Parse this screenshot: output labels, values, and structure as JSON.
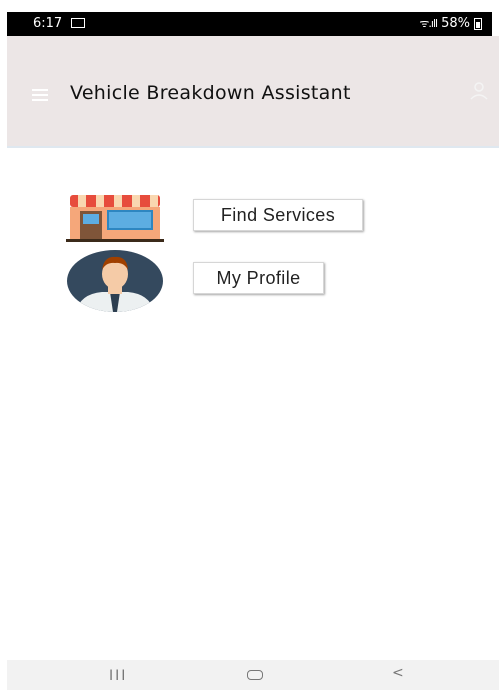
{
  "status_bar": {
    "time": "6:17",
    "signal": "ᯤ.ıll",
    "battery_percent": "58%",
    "icons": [
      "gallery-icon",
      "wifi-icon",
      "signal-icon",
      "battery-icon"
    ]
  },
  "app_bar": {
    "title": "Vehicle Breakdown Assistant",
    "icons": [
      "menu-icon",
      "account-icon"
    ]
  },
  "main": {
    "find_services_label": "Find Services",
    "my_profile_label": "My Profile",
    "icons": [
      "shop-icon",
      "person-avatar-icon"
    ]
  },
  "nav_bar": {
    "recent": "III",
    "back": "<"
  },
  "colors": {
    "app_bar_bg": "#ece6e6",
    "status_bar_bg": "#000000",
    "awning_red": "#e74c3c",
    "shop_blue": "#5dade2"
  }
}
